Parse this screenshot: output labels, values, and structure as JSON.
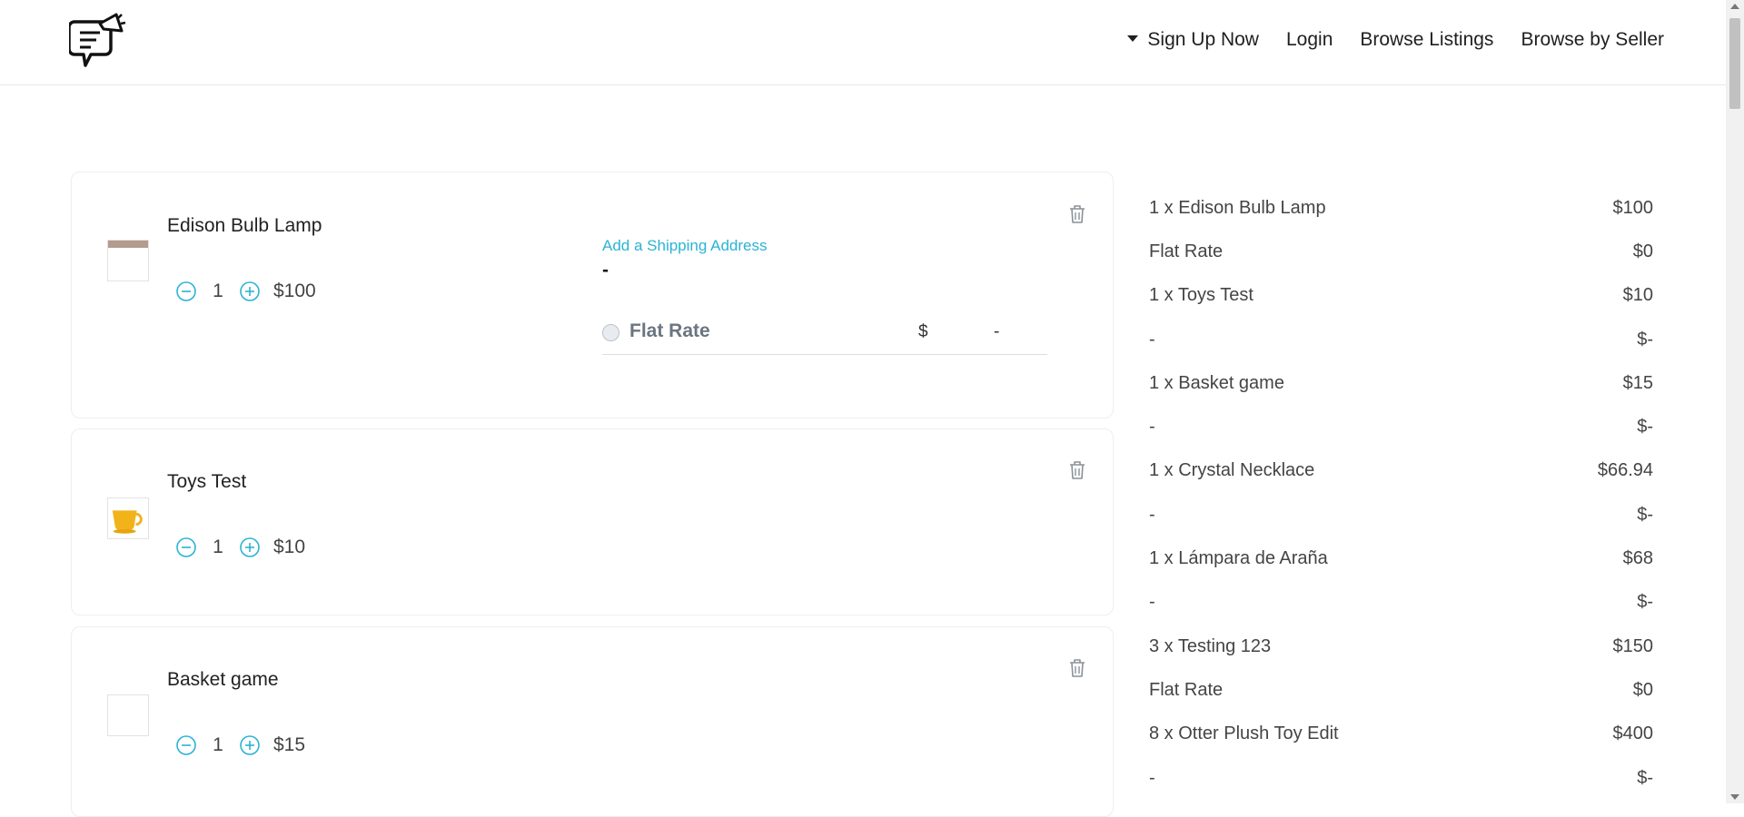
{
  "header": {
    "logo_icon": "megaphone-chat-logo-icon",
    "nav": {
      "signup": "Sign Up Now",
      "login": "Login",
      "browse_listings": "Browse Listings",
      "browse_seller": "Browse by Seller"
    }
  },
  "colors": {
    "accent": "#2bb3d4",
    "text": "#333333",
    "border": "#eeeeee"
  },
  "cart": {
    "items": [
      {
        "name": "Edison Bulb Lamp",
        "qty": "1",
        "price": "$100",
        "thumbnail_icon": "lamp-image",
        "shipping": {
          "link": "Add a Shipping Address",
          "address": "-",
          "method": "Flat Rate",
          "currency": "$",
          "cost": "-"
        }
      },
      {
        "name": "Toys Test",
        "qty": "1",
        "price": "$10",
        "thumbnail_icon": "yellow-cup-image"
      },
      {
        "name": "Basket game",
        "qty": "1",
        "price": "$15",
        "thumbnail_icon": "empty-image"
      }
    ]
  },
  "summary": {
    "rows": [
      {
        "label": "1 x Edison Bulb Lamp",
        "value": "$100"
      },
      {
        "label": "Flat Rate",
        "value": "$0"
      },
      {
        "label": "1 x Toys Test",
        "value": "$10"
      },
      {
        "label": "-",
        "value": "$-"
      },
      {
        "label": "1 x Basket game",
        "value": "$15"
      },
      {
        "label": "-",
        "value": "$-"
      },
      {
        "label": "1 x Crystal Necklace",
        "value": "$66.94"
      },
      {
        "label": "-",
        "value": "$-"
      },
      {
        "label": "1 x Lámpara de Araña",
        "value": "$68"
      },
      {
        "label": "-",
        "value": "$-"
      },
      {
        "label": "3 x Testing 123",
        "value": "$150"
      },
      {
        "label": "Flat Rate",
        "value": "$0"
      },
      {
        "label": "8 x Otter Plush Toy Edit",
        "value": "$400"
      },
      {
        "label": "-",
        "value": "$-"
      }
    ]
  }
}
